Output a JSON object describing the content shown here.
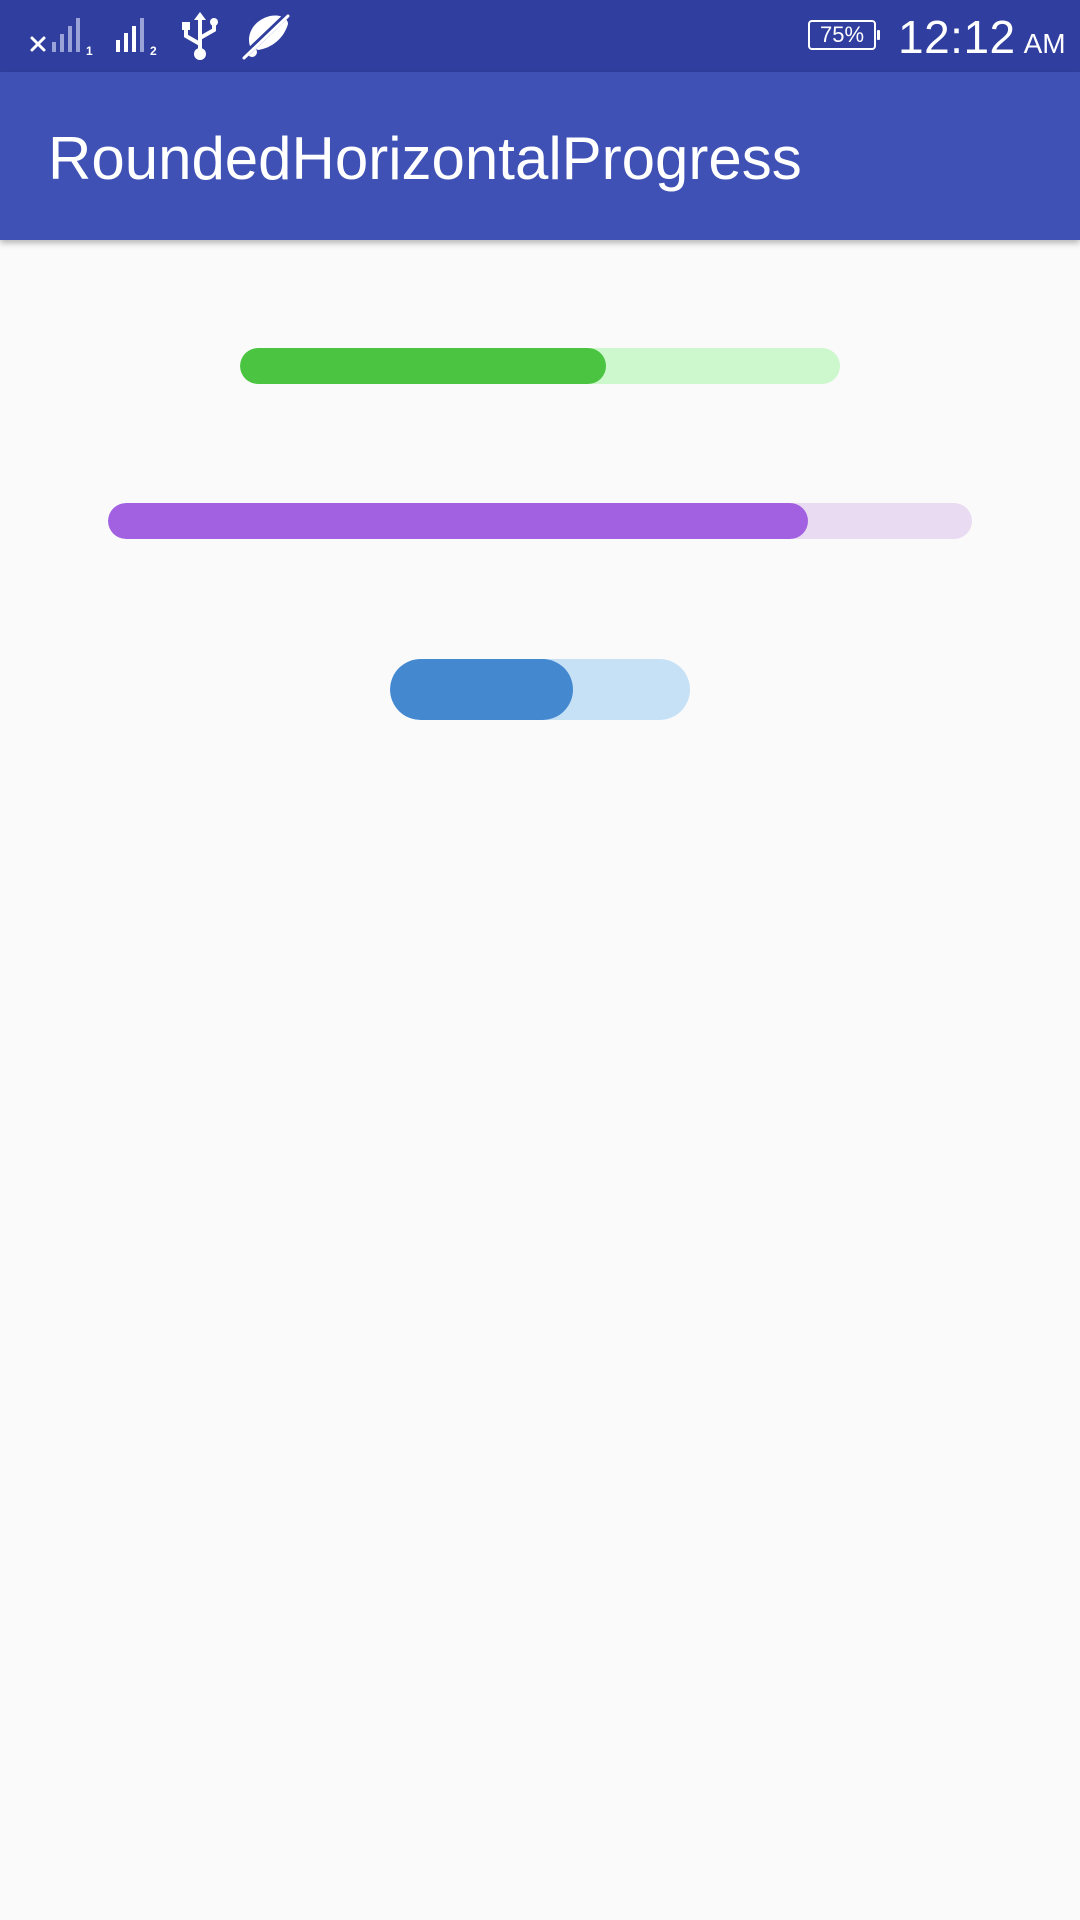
{
  "status_bar": {
    "battery_label": "75%",
    "time": "12:12",
    "ampm": "AM",
    "icons": [
      "signal-sim1-no-service-icon",
      "signal-sim2-icon",
      "usb-icon",
      "location-off-icon"
    ],
    "color": "#303f9f"
  },
  "app_bar": {
    "title": "RoundedHorizontalProgress",
    "color": "#3f51b5"
  },
  "progress_bars": [
    {
      "name": "progress-bar-green",
      "progress": 0.61,
      "fill_color": "#4bc541",
      "track_color": "#cdf7cd"
    },
    {
      "name": "progress-bar-purple",
      "progress": 0.81,
      "fill_color": "#a261e0",
      "track_color": "#e9dcf2"
    },
    {
      "name": "progress-bar-blue",
      "progress": 0.61,
      "fill_color": "#4489d0",
      "track_color": "#c6e1f6"
    }
  ]
}
